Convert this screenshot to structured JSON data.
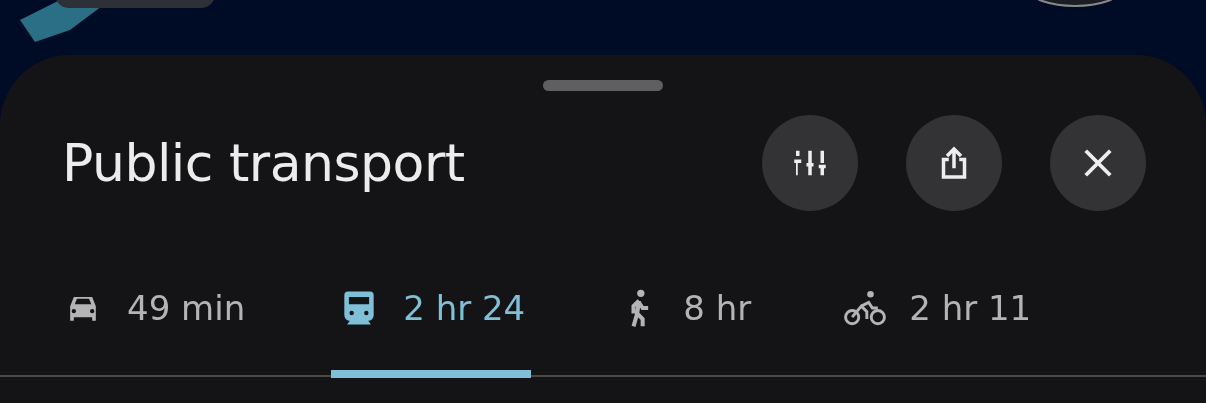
{
  "sheet": {
    "title": "Public transport"
  },
  "tabs": [
    {
      "kind": "car",
      "label": "49 min",
      "selected": false
    },
    {
      "kind": "train",
      "label": "2 hr 24",
      "selected": true
    },
    {
      "kind": "walk",
      "label": "8 hr",
      "selected": false
    },
    {
      "kind": "bike",
      "label": "2 hr 11",
      "selected": false
    }
  ]
}
